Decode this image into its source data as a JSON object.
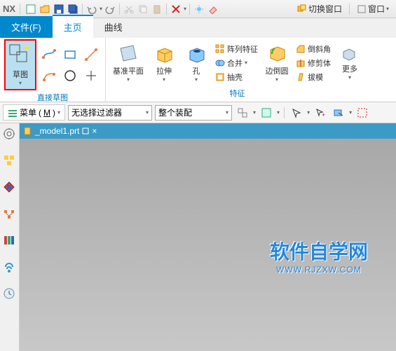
{
  "app": {
    "name": "NX"
  },
  "titlebar": {
    "switch_window": "切换窗口",
    "window": "窗口"
  },
  "tabs": {
    "file": "文件(F)",
    "home": "主页",
    "curve": "曲线"
  },
  "ribbon": {
    "sketch_group": {
      "sketch": "草图",
      "label": "直接草图"
    },
    "datum_group": {
      "datum_plane": "基准平面",
      "extrude": "拉伸",
      "hole": "孔"
    },
    "feature_group": {
      "pattern": "阵列特征",
      "unite": "合并",
      "shell": "抽壳",
      "edge_blend": "边倒圆",
      "chamfer": "倒斜角",
      "trim_body": "修剪体",
      "draft": "拔模",
      "more": "更多",
      "label": "特征"
    }
  },
  "toolbar2": {
    "menu": "菜单",
    "menu_key": "M",
    "filter_none": "无选择过滤器",
    "assembly": "整个装配"
  },
  "document": {
    "name": "_model1.prt"
  },
  "watermark": {
    "title": "软件自学网",
    "url": "WWW.RJZXW.COM"
  }
}
